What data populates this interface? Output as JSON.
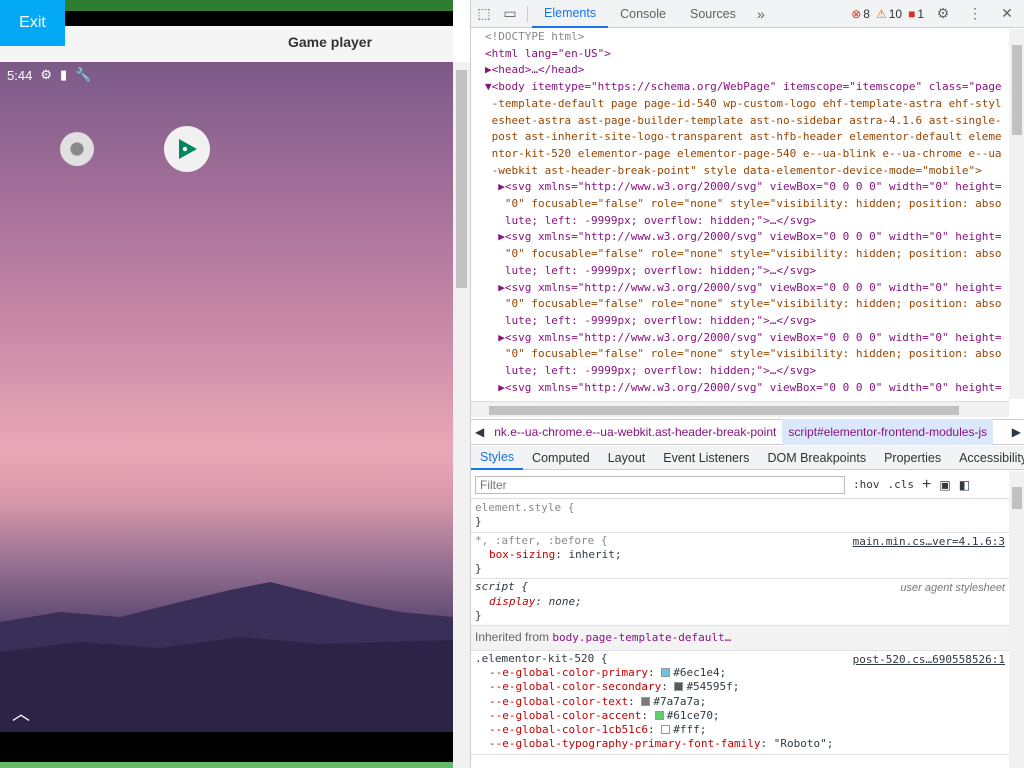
{
  "player": {
    "exit_label": "Exit",
    "title": "Game player",
    "status_time": "5:44",
    "chevron": "︿"
  },
  "devtools": {
    "tabs": [
      "Elements",
      "Console",
      "Sources"
    ],
    "more": "»",
    "errors": "8",
    "warnings": "10",
    "issues": "1",
    "dom_lines": [
      "<!DOCTYPE html>",
      "<html lang=\"en-US\">",
      "▶<head>…</head>",
      "▼<body itemtype=\"https://schema.org/WebPage\" itemscope=\"itemscope\" class=\"page",
      " -template-default page page-id-540 wp-custom-logo ehf-template-astra ehf-styl",
      " esheet-astra ast-page-builder-template ast-no-sidebar astra-4.1.6 ast-single-",
      " post ast-inherit-site-logo-transparent ast-hfb-header elementor-default eleme",
      " ntor-kit-520 elementor-page elementor-page-540 e--ua-blink e--ua-chrome e--ua",
      " -webkit ast-header-break-point\" style data-elementor-device-mode=\"mobile\">",
      "  ▶<svg xmlns=\"http://www.w3.org/2000/svg\" viewBox=\"0 0 0 0\" width=\"0\" height=",
      "   \"0\" focusable=\"false\" role=\"none\" style=\"visibility: hidden; position: abso",
      "   lute; left: -9999px; overflow: hidden;\">…</svg>",
      "  ▶<svg xmlns=\"http://www.w3.org/2000/svg\" viewBox=\"0 0 0 0\" width=\"0\" height=",
      "   \"0\" focusable=\"false\" role=\"none\" style=\"visibility: hidden; position: abso",
      "   lute; left: -9999px; overflow: hidden;\">…</svg>",
      "  ▶<svg xmlns=\"http://www.w3.org/2000/svg\" viewBox=\"0 0 0 0\" width=\"0\" height=",
      "   \"0\" focusable=\"false\" role=\"none\" style=\"visibility: hidden; position: abso",
      "   lute; left: -9999px; overflow: hidden;\">…</svg>",
      "  ▶<svg xmlns=\"http://www.w3.org/2000/svg\" viewBox=\"0 0 0 0\" width=\"0\" height=",
      "   \"0\" focusable=\"false\" role=\"none\" style=\"visibility: hidden; position: abso",
      "   lute; left: -9999px; overflow: hidden;\">…</svg>",
      "  ▶<svg xmlns=\"http://www.w3.org/2000/svg\" viewBox=\"0 0 0 0\" width=\"0\" height="
    ],
    "breadcrumb": [
      "nk.e--ua-chrome.e--ua-webkit.ast-header-break-point",
      "script#elementor-frontend-modules-js"
    ],
    "styles_tabs": [
      "Styles",
      "Computed",
      "Layout",
      "Event Listeners",
      "DOM Breakpoints",
      "Properties",
      "Accessibility"
    ],
    "filter_placeholder": "Filter",
    "hov": ":hov",
    "cls": ".cls",
    "rules": {
      "element_style": "element.style {",
      "close": "}",
      "universal_selector": "*, :after, :before {",
      "universal_source": "main.min.cs…ver=4.1.6:3",
      "box_sizing_name": "box-sizing",
      "box_sizing_value": "inherit;",
      "script_selector": "script {",
      "script_source": "user agent stylesheet",
      "display_name": "display",
      "display_value": "none;",
      "inherited_label": "Inherited from",
      "inherited_selector": "body.page-template-default…",
      "kit_selector": ".elementor-kit-520 {",
      "kit_source": "post-520.cs…690558526:1",
      "kit_props": [
        {
          "name": "--e-global-color-primary",
          "value": "#6ec1e4;",
          "color": "#6ec1e4"
        },
        {
          "name": "--e-global-color-secondary",
          "value": "#54595f;",
          "color": "#54595f"
        },
        {
          "name": "--e-global-color-text",
          "value": "#7a7a7a;",
          "color": "#7a7a7a"
        },
        {
          "name": "--e-global-color-accent",
          "value": "#61ce70;",
          "color": "#61ce70"
        },
        {
          "name": "--e-global-color-1cb51c6",
          "value": "#fff;",
          "color": "#ffffff"
        },
        {
          "name": "--e-global-typography-primary-font-family",
          "value": "\"Roboto\";",
          "color": ""
        }
      ]
    }
  }
}
